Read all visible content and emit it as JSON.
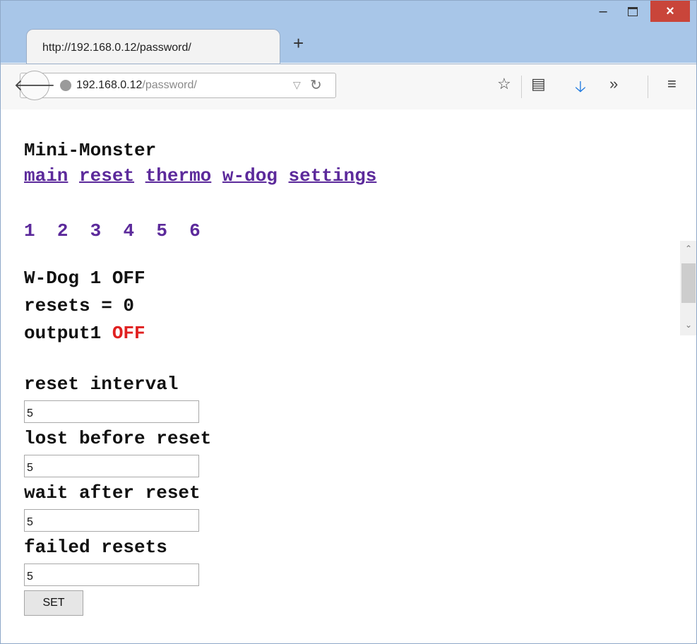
{
  "browser": {
    "tab_title": "http://192.168.0.12/password/",
    "new_tab_label": "+",
    "url_host": "192.168.0.12",
    "url_path": "/password/",
    "window_controls": {
      "minimize": "–",
      "close": "×"
    },
    "toolbar_icons": [
      "bookmark-star-icon",
      "reading-list-icon",
      "download-icon",
      "overflow-icon",
      "menu-icon"
    ]
  },
  "page": {
    "title": "Mini-Monster",
    "nav_links": [
      "main",
      "reset",
      "thermo",
      "w-dog",
      "settings"
    ],
    "channels": [
      "1",
      "2",
      "3",
      "4",
      "5",
      "6"
    ],
    "wdog_status": "W-Dog 1 OFF",
    "resets_line": "resets = 0",
    "output_label": "output1",
    "output_state": "OFF",
    "fields": [
      {
        "label": "reset interval",
        "value": "5"
      },
      {
        "label": "lost before reset",
        "value": "5"
      },
      {
        "label": "wait after reset",
        "value": "5"
      },
      {
        "label": "failed resets",
        "value": "5"
      }
    ],
    "set_button": "SET"
  }
}
